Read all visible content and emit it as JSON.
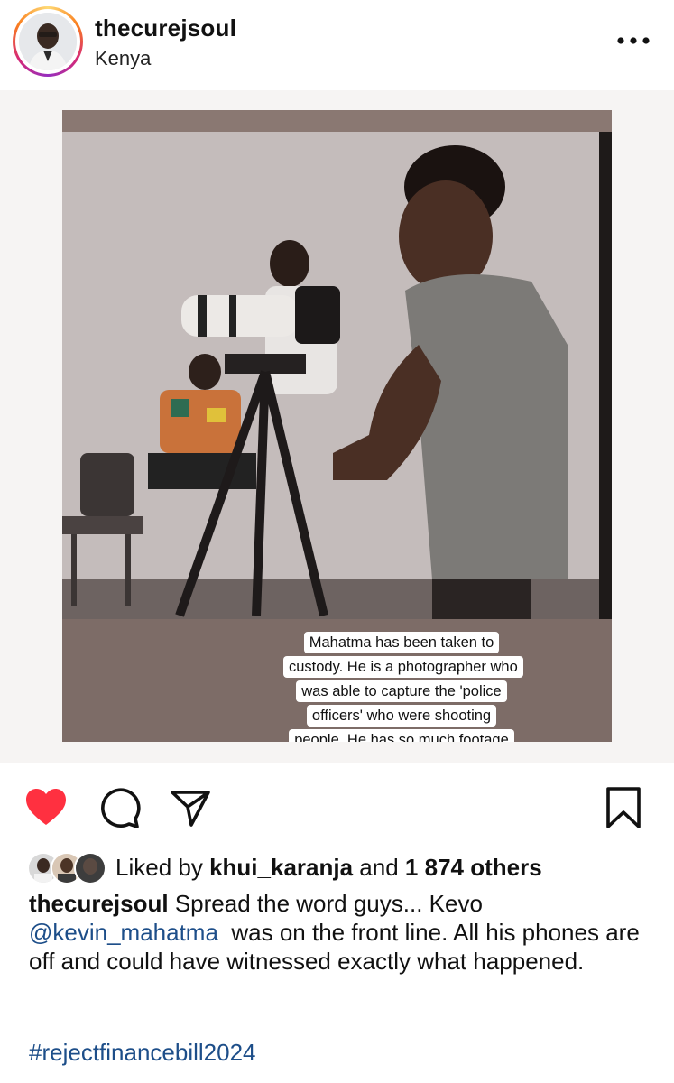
{
  "post": {
    "username": "thecurejsoul",
    "location": "Kenya",
    "overlay_text": "Mahatma has been taken to custody. He is a photographer who was able to capture the 'police officers' who were shooting people. He has so much footage with him, probably the reason they have him. REPOST, REPOST REPOST.",
    "likes": {
      "prefix": "Liked by",
      "user": "khui_karanja",
      "middle": "and",
      "count": "1 874 others"
    },
    "caption": {
      "username": "thecurejsoul",
      "text_before_mention": "Spread the word guys... Kevo",
      "mention": "@kevin_mahatma",
      "text_after_mention": "was on the front line. All his phones are off and could have witnessed exactly what happened.",
      "hashtag": "#rejectfinancebill2024"
    }
  },
  "icons": {
    "more": "more-horizontal-icon",
    "like": "heart-filled-icon",
    "comment": "comment-icon",
    "share": "paper-plane-icon",
    "save": "bookmark-icon"
  },
  "colors": {
    "like_red": "#ff3040",
    "link_blue": "#1d4e89",
    "story_ring": "#d62976"
  }
}
